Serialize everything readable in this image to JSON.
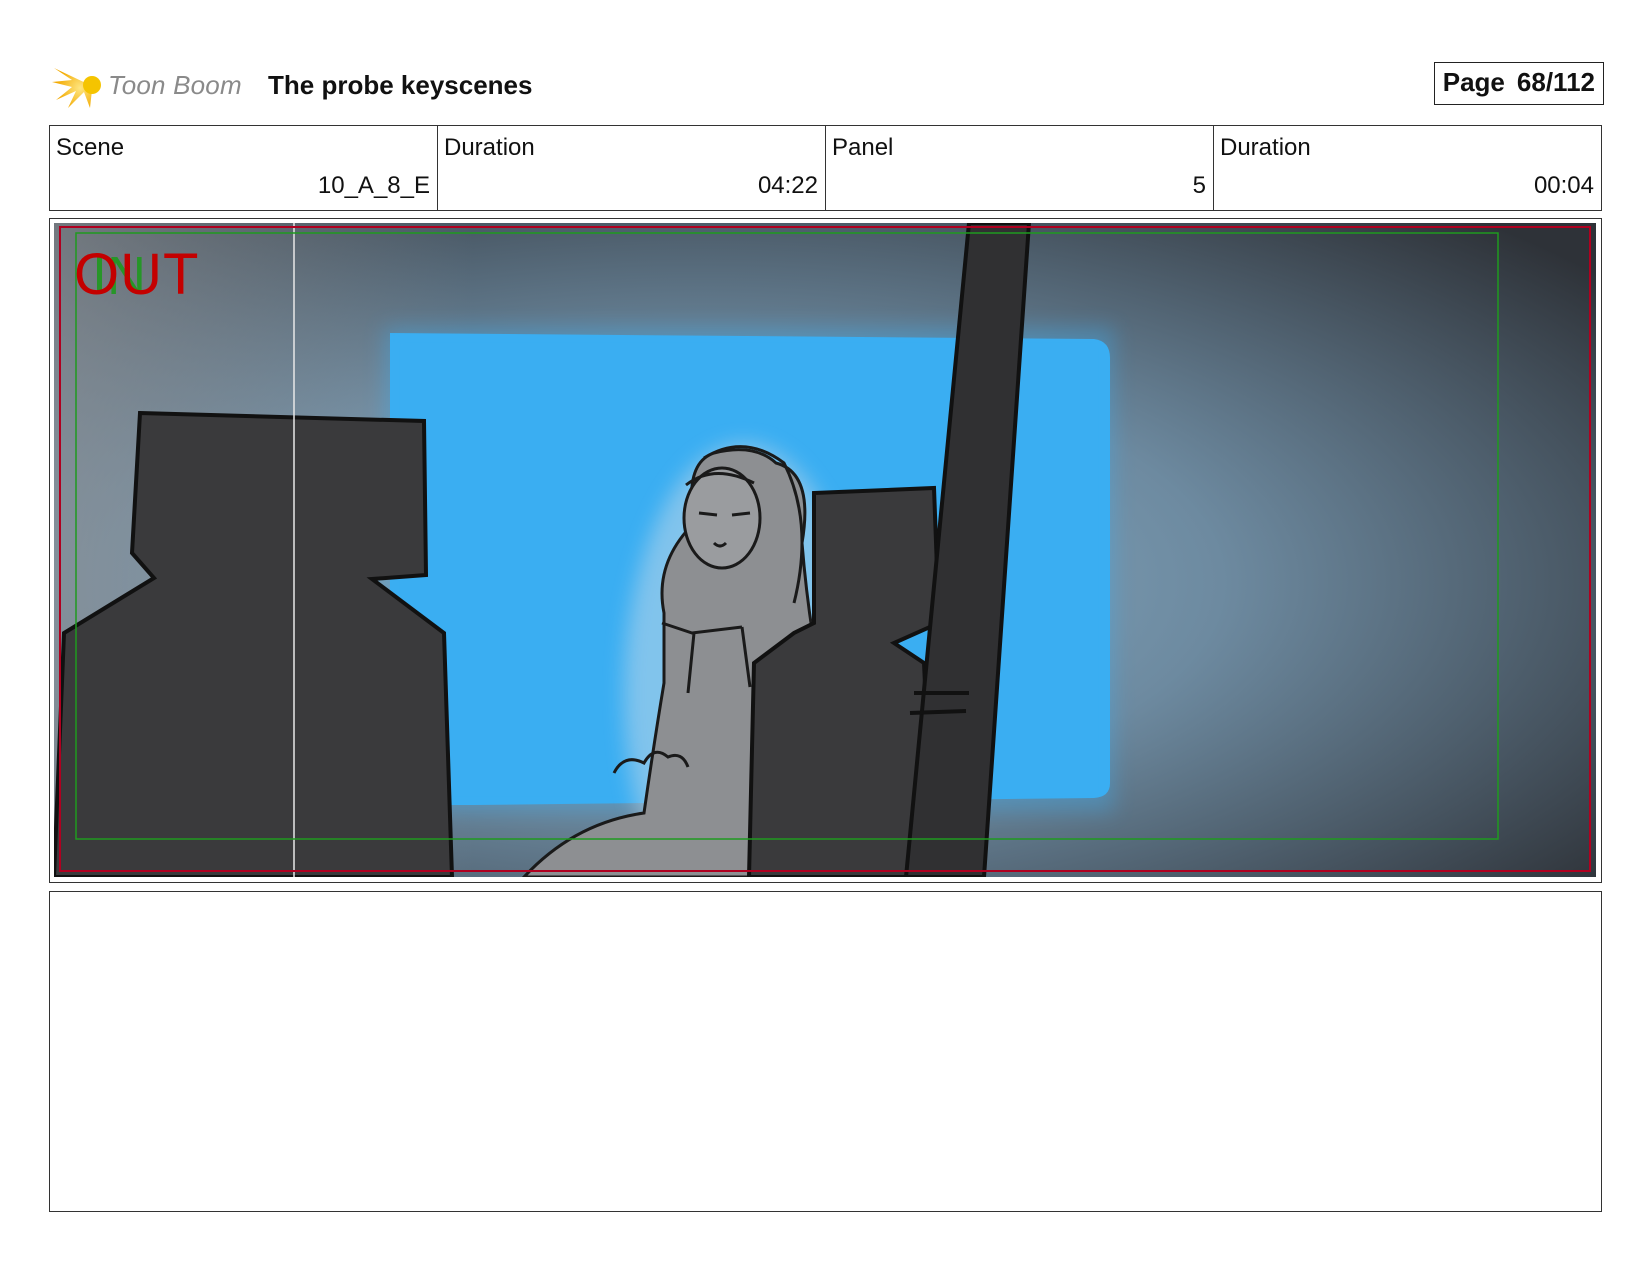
{
  "header": {
    "logo_text": "Toon Boom",
    "title": "The probe keyscenes",
    "page_label": "Page",
    "page_value": "68/112"
  },
  "info": {
    "scene_label": "Scene",
    "scene_value": "10_A_8_E",
    "scene_duration_label": "Duration",
    "scene_duration_value": "04:22",
    "panel_label": "Panel",
    "panel_value": "5",
    "panel_duration_label": "Duration",
    "panel_duration_value": "00:04"
  },
  "panel": {
    "out_label": "OUT",
    "in_label": "IN"
  },
  "notes": {
    "text": ""
  },
  "colors": {
    "window_blue": "#3aaef2",
    "frame_red": "#c40000",
    "frame_green": "#1f9a1f",
    "silhouette": "#3a3a3c"
  }
}
